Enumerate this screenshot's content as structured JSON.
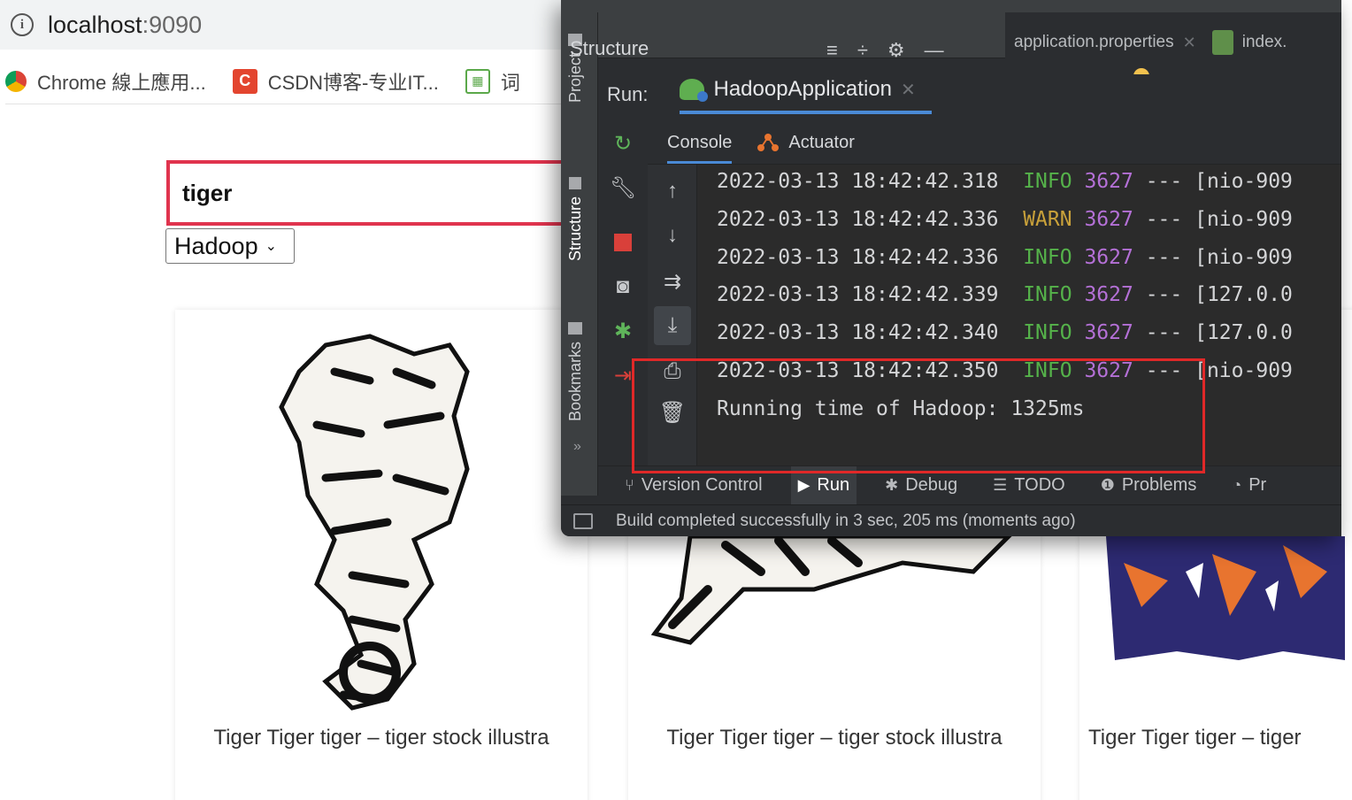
{
  "browser": {
    "url_host": "localhost",
    "url_port": ":9090",
    "bookmarks": [
      {
        "label": "Chrome 線上應用...",
        "icon": "chrome-icon"
      },
      {
        "label": "CSDN博客-专业IT...",
        "icon": "csdn-icon",
        "icon_text": "C"
      },
      {
        "label": "词",
        "icon": "dictionary-icon",
        "icon_text": "词"
      }
    ]
  },
  "search": {
    "query": "tiger",
    "engine": "Hadoop"
  },
  "results": [
    {
      "caption": "Tiger Tiger tiger – tiger stock illustra"
    },
    {
      "caption": "Tiger Tiger tiger – tiger stock illustra"
    },
    {
      "caption": "Tiger Tiger tiger – tiger"
    }
  ],
  "ide": {
    "side_tabs": [
      "Project",
      "Structure",
      "Bookmarks"
    ],
    "structure_title": "Structure",
    "file_tabs": [
      {
        "label": "application.properties"
      },
      {
        "label": "index."
      }
    ],
    "run_label": "Run:",
    "run_config": "HadoopApplication",
    "console_tabs": [
      "Console",
      "Actuator"
    ],
    "log_lines": [
      {
        "ts": "2022-03-13 18:42:42.318",
        "level": "INFO",
        "pid": "3627",
        "sep": "---",
        "thread": "[nio-909"
      },
      {
        "ts": "2022-03-13 18:42:42.336",
        "level": "WARN",
        "pid": "3627",
        "sep": "---",
        "thread": "[nio-909"
      },
      {
        "ts": "2022-03-13 18:42:42.336",
        "level": "INFO",
        "pid": "3627",
        "sep": "---",
        "thread": "[nio-909"
      },
      {
        "ts": "2022-03-13 18:42:42.339",
        "level": "INFO",
        "pid": "3627",
        "sep": "---",
        "thread": "[127.0.0"
      },
      {
        "ts": "2022-03-13 18:42:42.340",
        "level": "INFO",
        "pid": "3627",
        "sep": "---",
        "thread": "[127.0.0"
      },
      {
        "ts": "2022-03-13 18:42:42.350",
        "level": "INFO",
        "pid": "3627",
        "sep": "---",
        "thread": "[nio-909"
      }
    ],
    "result_line": "Running time of Hadoop: 1325ms",
    "bottom_tabs": [
      {
        "label": "Version Control",
        "icon": "version-control-icon"
      },
      {
        "label": "Run",
        "icon": "run-icon"
      },
      {
        "label": "Debug",
        "icon": "debug-icon"
      },
      {
        "label": "TODO",
        "icon": "todo-icon"
      },
      {
        "label": "Problems",
        "icon": "problems-icon"
      },
      {
        "label": "Pr",
        "icon": "profiler-icon"
      }
    ],
    "status_text": "Build completed successfully in 3 sec, 205 ms (moments ago)",
    "colors": {
      "info": "#55b24a",
      "warn": "#c9a13a",
      "pid": "#b470d6",
      "highlight": "#e02828",
      "search_border": "#e0344e"
    }
  }
}
